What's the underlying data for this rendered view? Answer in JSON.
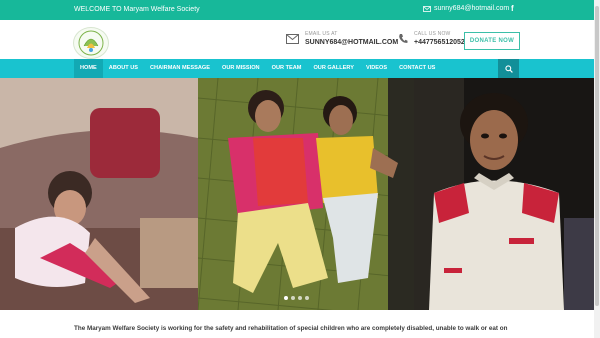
{
  "topbar": {
    "welcome": "WELCOME TO Maryam Welfare Society",
    "email": "sunny684@hotmail.com",
    "facebook_glyph": "f"
  },
  "header": {
    "logo_text": "MARYAM WELFARE SOCIETY",
    "email_caption": "EMAIL US AT",
    "email_value": "SUNNY684@HOTMAIL.COM",
    "call_caption": "CALL US NOW",
    "call_value": "+447756512052",
    "donate_label": "DONATE NOW"
  },
  "nav": {
    "items": [
      "HOME",
      "ABOUT US",
      "CHAIRMAN MESSAGE",
      "OUR MISSION",
      "OUR TEAM",
      "OUR GALLERY",
      "VIDEOS",
      "CONTACT US"
    ]
  },
  "slider": {
    "dots": 4,
    "active_dot": 0
  },
  "intro": {
    "text": "The Maryam Welfare Society is working for the safety and rehabilitation of special children who are completely disabled, unable to walk or eat on"
  },
  "colors": {
    "teal": "#17b89a",
    "nav": "#19c3cf",
    "nav_active": "#12a9b4",
    "accent": "#3bbfa8"
  },
  "icons": [
    "mail-icon",
    "facebook-icon",
    "envelope-icon",
    "phone-icon",
    "search-icon"
  ]
}
